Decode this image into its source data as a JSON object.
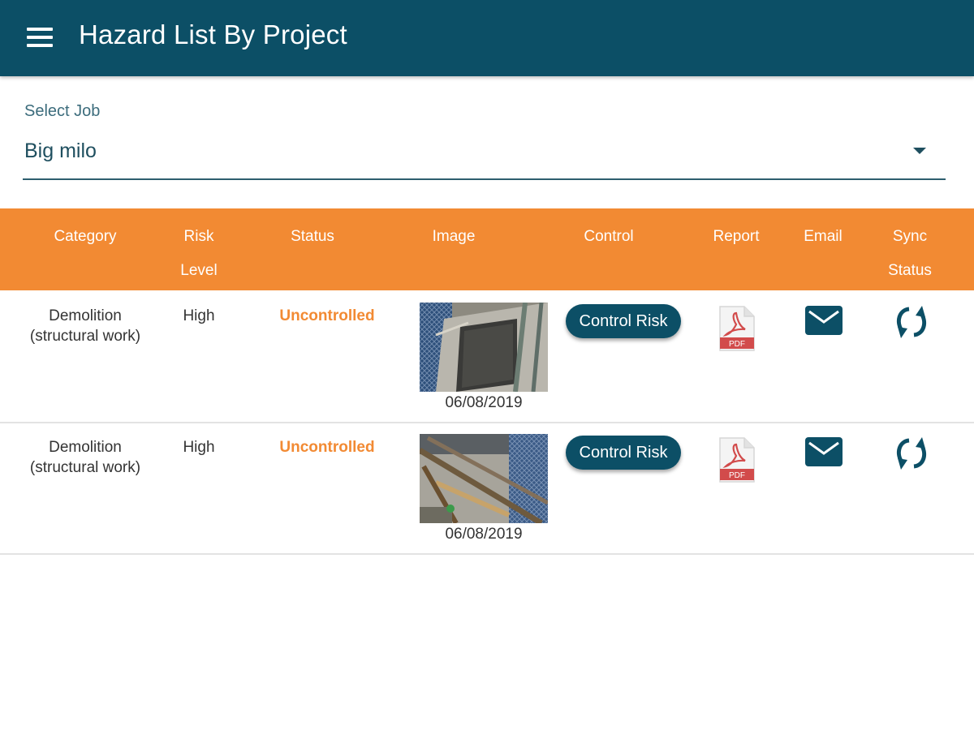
{
  "appbar": {
    "title": "Hazard List By Project",
    "menu_icon": "hamburger-menu-icon",
    "color": "#0c4f66"
  },
  "job_select": {
    "label": "Select Job",
    "value": "Big milo",
    "dropdown_icon": "caret-down-icon"
  },
  "table": {
    "header_color": "#f28a33",
    "columns": [
      {
        "key": "category",
        "label": "Category"
      },
      {
        "key": "risk_level",
        "label": "Risk\nLevel"
      },
      {
        "key": "status",
        "label": "Status"
      },
      {
        "key": "image",
        "label": "Image"
      },
      {
        "key": "control",
        "label": "Control"
      },
      {
        "key": "report",
        "label": "Report"
      },
      {
        "key": "email",
        "label": "Email"
      },
      {
        "key": "sync_status",
        "label": "Sync\nStatus"
      }
    ],
    "rows": [
      {
        "category": "Demolition\n(structural work)",
        "risk_level": "High",
        "status": "Uncontrolled",
        "image_date": "06/08/2019",
        "control_label": "Control Risk",
        "report_icon": "pdf-icon",
        "email_icon": "envelope-icon",
        "sync_icon": "sync-icon"
      },
      {
        "category": "Demolition\n(structural work)",
        "risk_level": "High",
        "status": "Uncontrolled",
        "image_date": "06/08/2019",
        "control_label": "Control Risk",
        "report_icon": "pdf-icon",
        "email_icon": "envelope-icon",
        "sync_icon": "sync-icon"
      }
    ]
  },
  "pdf_badge": "PDF"
}
